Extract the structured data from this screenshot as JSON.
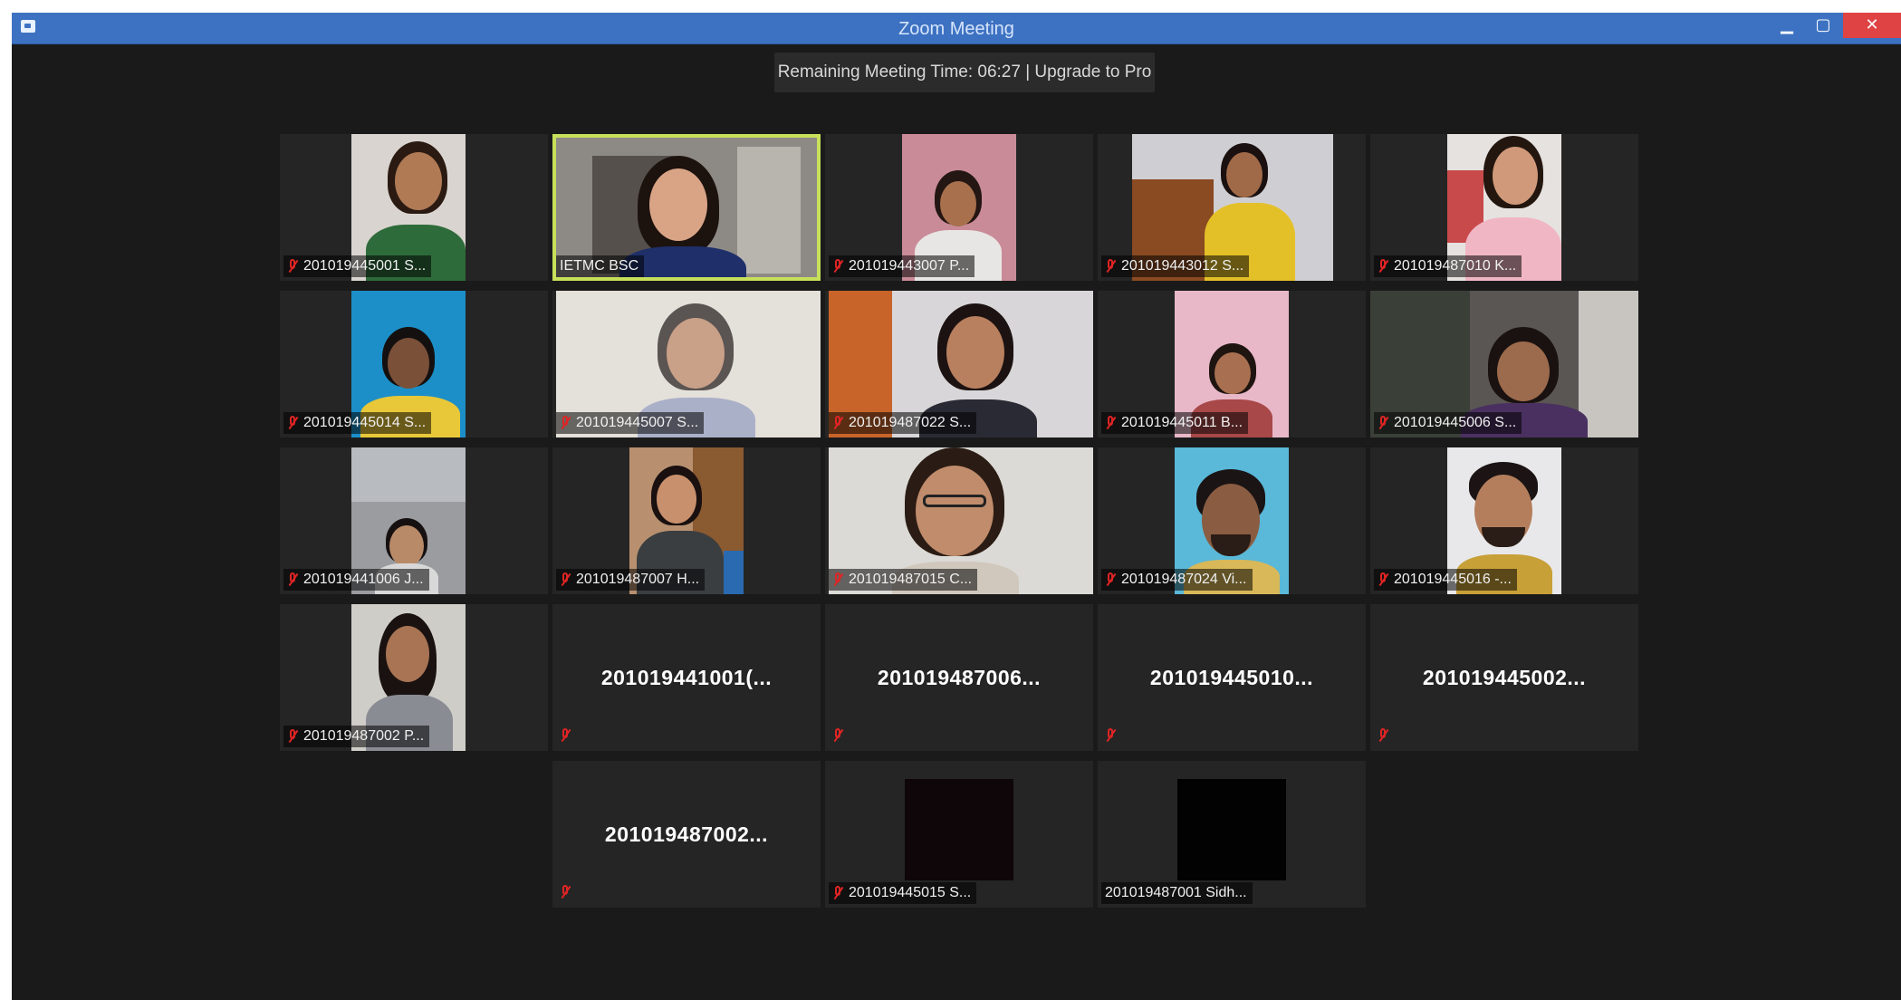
{
  "window": {
    "title": "Zoom Meeting",
    "buttons": {
      "minimize": "▁",
      "maximize": "▢",
      "close": "✕"
    }
  },
  "meeting": {
    "timer_text": "Remaining Meeting Time: 06:27 | Upgrade to Pro"
  },
  "participants": [
    {
      "label": "201019445001 S...",
      "muted": true
    },
    {
      "label": "IETMC BSC",
      "muted": false,
      "active_speaker": true
    },
    {
      "label": "201019443007 P...",
      "muted": true
    },
    {
      "label": "201019443012 S...",
      "muted": true
    },
    {
      "label": "201019487010 K...",
      "muted": true
    },
    {
      "label": "201019445014 S...",
      "muted": true
    },
    {
      "label": "201019445007 S...",
      "muted": true
    },
    {
      "label": "201019487022 S...",
      "muted": true
    },
    {
      "label": "201019445011 B...",
      "muted": true
    },
    {
      "label": "201019445006 S...",
      "muted": true
    },
    {
      "label": "201019441006 J...",
      "muted": true
    },
    {
      "label": "201019487007 H...",
      "muted": true
    },
    {
      "label": "201019487015 C...",
      "muted": true
    },
    {
      "label": "201019487024 Vi...",
      "muted": true
    },
    {
      "label": "201019445016 -...",
      "muted": true
    },
    {
      "label": "201019487002 P...",
      "muted": true
    },
    {
      "label": "201019441001(...",
      "muted": true,
      "video_off": true
    },
    {
      "label": "201019487006...",
      "muted": true,
      "video_off": true
    },
    {
      "label": "201019445010...",
      "muted": true,
      "video_off": true
    },
    {
      "label": "201019445002...",
      "muted": true,
      "video_off": true
    },
    {
      "label": "201019487002...",
      "muted": true,
      "video_off": true
    },
    {
      "label": "201019445015 S...",
      "muted": true
    },
    {
      "label": "201019487001 Sidh...",
      "muted": false
    }
  ],
  "colors": {
    "titlebar": "#3d72c2",
    "background": "#1a1a1a",
    "tile": "#252525",
    "active_speaker_border": "#c7e05a",
    "muted_icon": "#e02424"
  }
}
